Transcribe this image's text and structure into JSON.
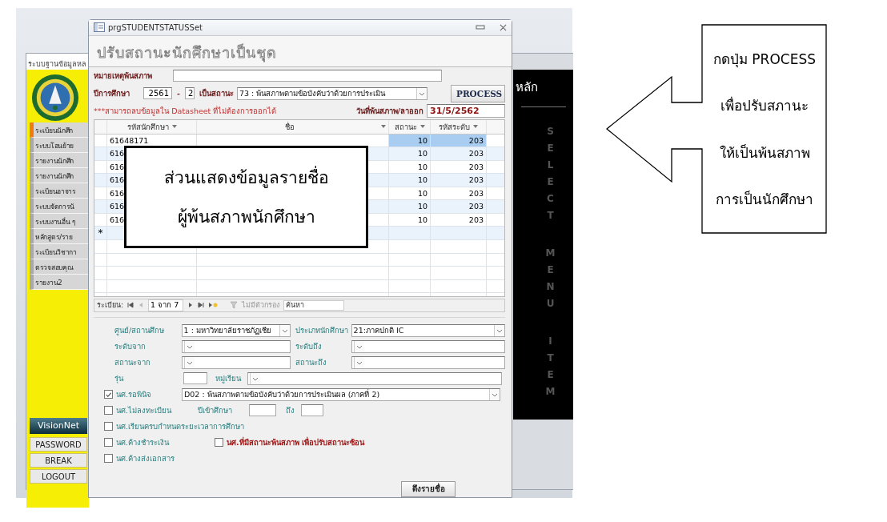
{
  "back_window": {
    "title": "ระบบฐานข้อมูลหล",
    "menu": [
      {
        "label": "ระเบียนนักศึก",
        "selected": true
      },
      {
        "label": "ระบบโอนย้าย",
        "selected": false
      },
      {
        "label": "รายงานนักศึก",
        "selected": false
      },
      {
        "label": "รายงานนักศึก",
        "selected": false
      },
      {
        "label": "ระเบียนอาจาร",
        "selected": false
      },
      {
        "label": "ระบบจัดการนั",
        "selected": false
      },
      {
        "label": "ระบบงานอื่น ๆ",
        "selected": false
      },
      {
        "label": "หลักสูตร/ราย",
        "selected": false
      },
      {
        "label": "ระเบียนวิชากา",
        "selected": false
      },
      {
        "label": "ตรวจสอบคุณ",
        "selected": false
      },
      {
        "label": "รายงาน2",
        "selected": false
      }
    ],
    "brand": "VisionNet",
    "buttons": [
      "PASSWORD",
      "BREAK",
      "LOGOUT"
    ],
    "panel_title": "หลัก",
    "banner_words": [
      "SELECT",
      "MENU",
      "ITEM"
    ]
  },
  "dialog": {
    "title": "prgSTUDENTSTATUSSet",
    "heading": "ปรับสถานะนักศึกษาเป็นชุด",
    "remark_label": "หมายเหตุพ้นสภาพ",
    "year_label": "ปีการศึกษา",
    "year": "2561",
    "dash": "-",
    "term": "2",
    "status_label": "เป็นสถานะ",
    "status_value": "73 : พ้นสภาพตามข้อบังคับว่าด้วยการประเมิน",
    "process_button": "PROCESS",
    "note": "***สามารถลบข้อมูลใน Datasheet ที่ไม่ต้องการออกได้",
    "date_label": "วันที่พ้นสภาพ/ลาออก",
    "date_value": "31/5/2562",
    "table": {
      "columns": [
        "รหัสนักศึกษา",
        "ชื่อ",
        "สถานะ",
        "รหัสระดับ"
      ],
      "rows": [
        {
          "student_id": "61648171",
          "status": "10",
          "level_code": "203",
          "selected": true
        },
        {
          "student_id": "616",
          "status": "10",
          "level_code": "203",
          "selected": false
        },
        {
          "student_id": "616",
          "status": "10",
          "level_code": "203",
          "selected": false
        },
        {
          "student_id": "616",
          "status": "10",
          "level_code": "203",
          "selected": false
        },
        {
          "student_id": "616",
          "status": "10",
          "level_code": "203",
          "selected": false
        },
        {
          "student_id": "616",
          "status": "10",
          "level_code": "203",
          "selected": false
        },
        {
          "student_id": "616",
          "status": "10",
          "level_code": "203",
          "selected": false
        }
      ],
      "new_row_marker": "*"
    },
    "navigator": {
      "label": "ระเบียน:",
      "position": "1 จาก 7",
      "filter": "ไม่มีตัวกรอง",
      "search_placeholder": "ค้นหา"
    },
    "criteria": {
      "campus_label": "ศูนย์/สถานศึกษ",
      "campus_value": "1 : มหาวิทยาลัยราชภัฏเชีย",
      "type_label": "ประเภทนักศึกษา",
      "type_value": "21:ภาคปกติ IC",
      "level_from_label": "ระดับจาก",
      "level_to_label": "ระดับถึง",
      "status_from_label": "สถานะจาก",
      "status_to_label": "สถานะถึง",
      "cohort_label": "รุ่น",
      "section_label": "หมู่เรียน",
      "check_rows": [
        [
          {
            "kind": "combo",
            "label": "นศ.รอพินิจ",
            "checked": true,
            "value": "D02 : พ้นสภาพตามข้อบังคับว่าด้วยการประเมินผล (ภาคที่ 2)"
          }
        ],
        [
          {
            "kind": "year_range",
            "label": "นศ.ไม่ลงทะเบียน",
            "checked": false,
            "from_label": "ปีเข้าศึกษา",
            "to_label": "ถึง"
          }
        ],
        [
          {
            "kind": "plain",
            "label": "นศ.เรียนครบกำหนดระยะเวลาการศึกษา",
            "checked": false
          }
        ],
        [
          {
            "kind": "plain",
            "label": "นศ.ค้างชำระเงิน",
            "checked": false
          },
          {
            "kind": "alert",
            "label": "นศ.ที่มีสถานะพ้นสภาพ เพื่อปรับสถานะซ้อน",
            "checked": false
          }
        ],
        [
          {
            "kind": "plain",
            "label": "นศ.ค้างส่งเอกสาร",
            "checked": false
          }
        ]
      ]
    },
    "fetch_button": "ดึงรายชื่อ"
  },
  "list_callout": [
    "ส่วนแสดงข้อมูลรายชื่อ",
    "ผู้พ้นสภาพนักศึกษา"
  ],
  "arrow_callout": [
    "กดปุ่ม PROCESS",
    "เพื่อปรับสภานะ",
    "ให้เป็นพ้นสภาพ",
    "การเป็นนักศึกษา"
  ]
}
